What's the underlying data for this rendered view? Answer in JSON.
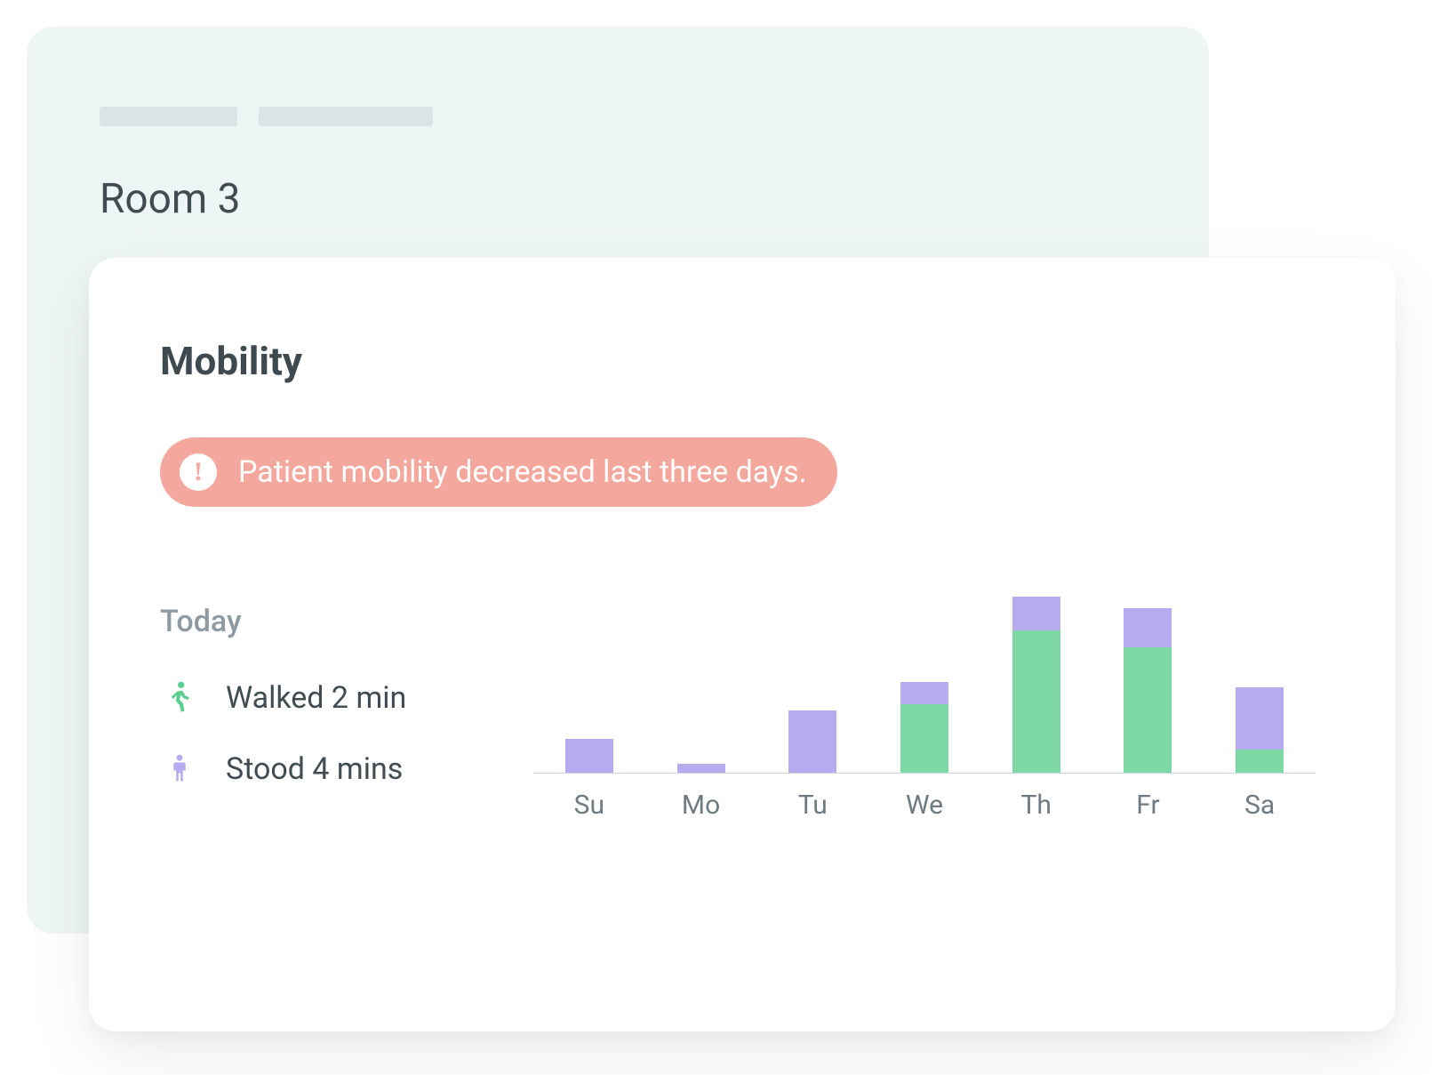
{
  "back_card": {
    "title": "Room 3"
  },
  "front_card": {
    "title": "Mobility",
    "alert": "Patient mobility decreased last three days.",
    "today_label": "Today",
    "stats": {
      "walked": "Walked 2 min",
      "stood": "Stood 4 mins"
    }
  },
  "colors": {
    "walk": "#7ed8a3",
    "stand": "#b6abee",
    "alert_bg": "#f4a79c",
    "back_bg": "#eef5f5"
  },
  "chart_data": {
    "type": "bar",
    "title": "",
    "xlabel": "",
    "ylabel": "",
    "ylim": [
      0,
      180
    ],
    "categories": [
      "Su",
      "Mo",
      "Tu",
      "We",
      "Th",
      "Fr",
      "Sa"
    ],
    "series": [
      {
        "name": "Walked",
        "color": "#7ed8a3",
        "values": [
          0,
          0,
          0,
          60,
          125,
          110,
          20
        ]
      },
      {
        "name": "Stood",
        "color": "#b6abee",
        "values": [
          30,
          8,
          55,
          20,
          30,
          35,
          55
        ]
      }
    ],
    "note": "Values are pixel-height estimates read from the unlabeled axis; chart has no numeric ticks."
  }
}
